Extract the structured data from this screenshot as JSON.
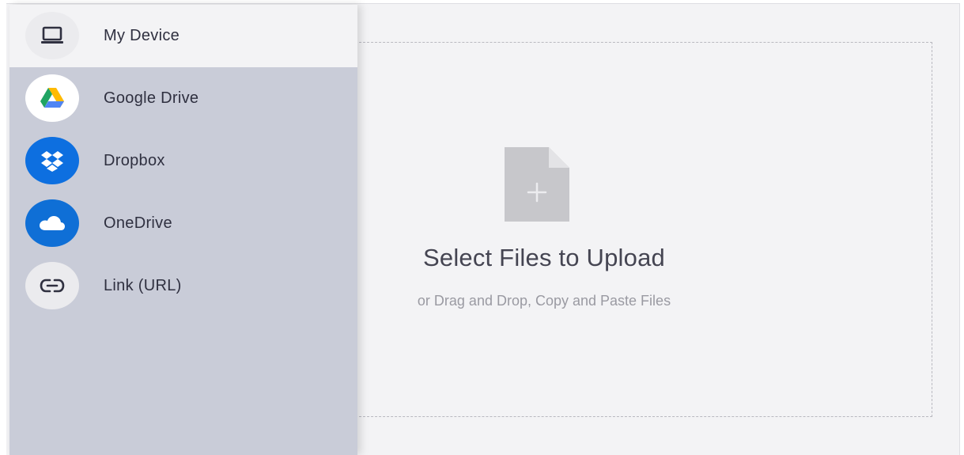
{
  "sources": [
    {
      "label": "My Device",
      "icon": "laptop-icon",
      "active": true
    },
    {
      "label": "Google Drive",
      "icon": "google-drive-icon",
      "active": false
    },
    {
      "label": "Dropbox",
      "icon": "dropbox-icon",
      "active": false
    },
    {
      "label": "OneDrive",
      "icon": "onedrive-icon",
      "active": false
    },
    {
      "label": "Link (URL)",
      "icon": "link-icon",
      "active": false
    }
  ],
  "dropzone": {
    "title": "Select Files to Upload",
    "subtitle": "or Drag and Drop, Copy and Paste Files",
    "icon": "file-add-icon"
  },
  "colors": {
    "sidebar_bg": "#c9ccd8",
    "active_bg": "#f3f3f5",
    "dropbox_blue": "#0d6fe0",
    "onedrive_blue": "#0f6fd6",
    "drive_green": "#20a463",
    "drive_yellow": "#ffba00",
    "drive_blue": "#4f85f4"
  }
}
